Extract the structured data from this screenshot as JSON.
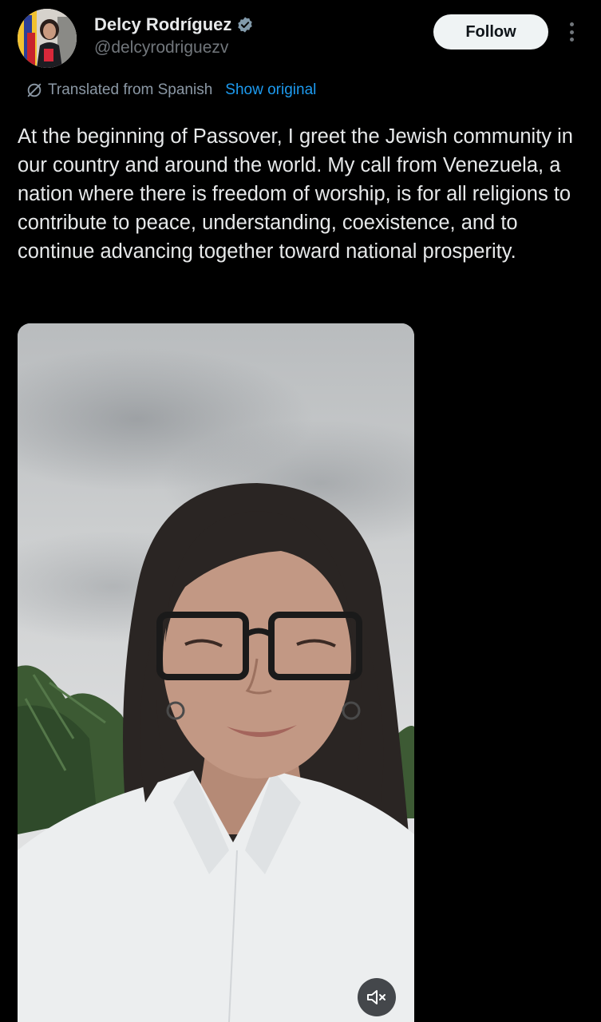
{
  "author": {
    "display_name": "Delcy Rodríguez",
    "handle": "@delcyrodriguezv",
    "verified": true,
    "verified_icon": "verified-badge-icon"
  },
  "actions": {
    "follow_label": "Follow",
    "more_icon": "more-options-icon"
  },
  "translation": {
    "note": "Translated from Spanish",
    "show_original_label": "Show original",
    "icon": "translate-icon"
  },
  "tweet": {
    "text": "At the beginning of Passover, I greet the Jewish community in our country and around the world. My call from Venezuela, a nation where there is freedom of worship, is for all religions to contribute to peace, understanding, coexistence, and to continue advancing together toward national prosperity."
  },
  "video": {
    "mute_icon": "volume-muted-icon"
  },
  "colors": {
    "background": "#000000",
    "text_primary": "#e7e9ea",
    "text_secondary": "#71767b",
    "link": "#1d9bf0",
    "follow_button_bg": "#eff3f4"
  }
}
